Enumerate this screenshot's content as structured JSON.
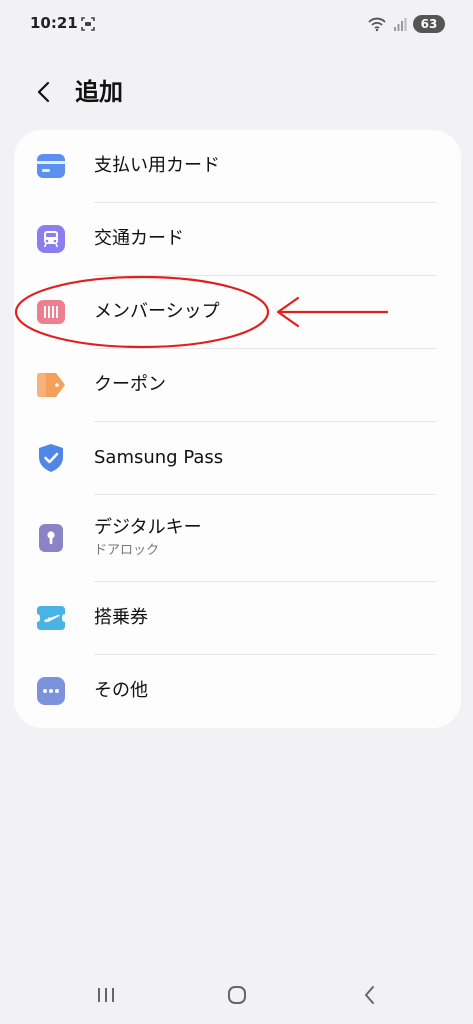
{
  "status_bar": {
    "time": "10:21",
    "battery": "63"
  },
  "header": {
    "title": "追加"
  },
  "items": [
    {
      "label": "支払い用カード",
      "icon": "credit-card-icon"
    },
    {
      "label": "交通カード",
      "icon": "transit-card-icon"
    },
    {
      "label": "メンバーシップ",
      "icon": "barcode-icon"
    },
    {
      "label": "クーポン",
      "icon": "coupon-tag-icon"
    },
    {
      "label": "Samsung Pass",
      "icon": "shield-check-icon"
    },
    {
      "label": "デジタルキー",
      "sublabel": "ドアロック",
      "icon": "keyhole-icon"
    },
    {
      "label": "搭乗券",
      "icon": "airplane-ticket-icon"
    },
    {
      "label": "その他",
      "icon": "more-dots-icon"
    }
  ],
  "colors": {
    "background": "#f2f2f4",
    "card": "#fdfdfd",
    "annotation": "#e0201e",
    "payment_icon": "#5b8ff0",
    "transit_icon": "#8b7ef0",
    "membership_icon": "#ee7f91",
    "coupon_icon": "#f5a05a",
    "pass_icon": "#4f86e8",
    "digital_key_icon": "#8a84c6",
    "boarding_icon": "#4ab3e6",
    "other_icon": "#7d92dc"
  }
}
